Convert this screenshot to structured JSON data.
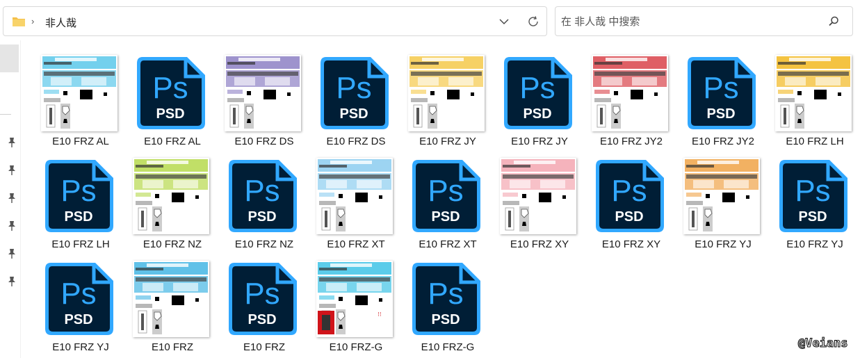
{
  "address": {
    "path": [
      "非人哉"
    ],
    "current": "非人哉"
  },
  "search": {
    "placeholder": "在 非人哉 中搜索"
  },
  "colors": {
    "psd_bg": "#001e36",
    "psd_accent": "#31a8ff",
    "folder": "#f5c04a"
  },
  "icons": {
    "folder": "folder-icon",
    "breadcrumb_chevron": "chevron-right-icon",
    "dropdown": "chevron-down-icon",
    "refresh": "refresh-icon",
    "search": "search-icon",
    "pin": "pin-icon",
    "psd": "photoshop-file-icon"
  },
  "psd_icon": {
    "logo": "Ps",
    "ext": "PSD"
  },
  "files": [
    {
      "name": "E10 FRZ AL",
      "kind": "image",
      "accent": "#5bc8ea"
    },
    {
      "name": "E10 FRZ AL",
      "kind": "psd"
    },
    {
      "name": "E10 FRZ DS",
      "kind": "image",
      "accent": "#8d80c4"
    },
    {
      "name": "E10 FRZ DS",
      "kind": "psd"
    },
    {
      "name": "E10 FRZ JY",
      "kind": "image",
      "accent": "#f5c94a"
    },
    {
      "name": "E10 FRZ JY",
      "kind": "psd"
    },
    {
      "name": "E10 FRZ JY2",
      "kind": "image",
      "accent": "#d9434a"
    },
    {
      "name": "E10 FRZ JY2",
      "kind": "psd"
    },
    {
      "name": "E10 FRZ LH",
      "kind": "image",
      "accent": "#f2b820"
    },
    {
      "name": "E10 FRZ LH",
      "kind": "psd"
    },
    {
      "name": "E10 FRZ NZ",
      "kind": "image",
      "accent": "#b6d94c"
    },
    {
      "name": "E10 FRZ NZ",
      "kind": "psd"
    },
    {
      "name": "E10 FRZ XT",
      "kind": "image",
      "accent": "#8ccdf0"
    },
    {
      "name": "E10 FRZ XT",
      "kind": "psd"
    },
    {
      "name": "E10 FRZ XY",
      "kind": "image",
      "accent": "#f3a6b0"
    },
    {
      "name": "E10 FRZ XY",
      "kind": "psd"
    },
    {
      "name": "E10 FRZ YJ",
      "kind": "image",
      "accent": "#f0a347"
    },
    {
      "name": "E10 FRZ YJ",
      "kind": "psd"
    },
    {
      "name": "E10 FRZ YJ",
      "kind": "psd"
    },
    {
      "name": "E10 FRZ",
      "kind": "image",
      "accent": "#44b6e4"
    },
    {
      "name": "E10 FRZ",
      "kind": "psd"
    },
    {
      "name": "E10 FRZ-G",
      "kind": "image",
      "accent": "#3ec3e6",
      "red_badge": true
    },
    {
      "name": "E10 FRZ-G",
      "kind": "psd"
    }
  ],
  "watermark": "@Veians"
}
